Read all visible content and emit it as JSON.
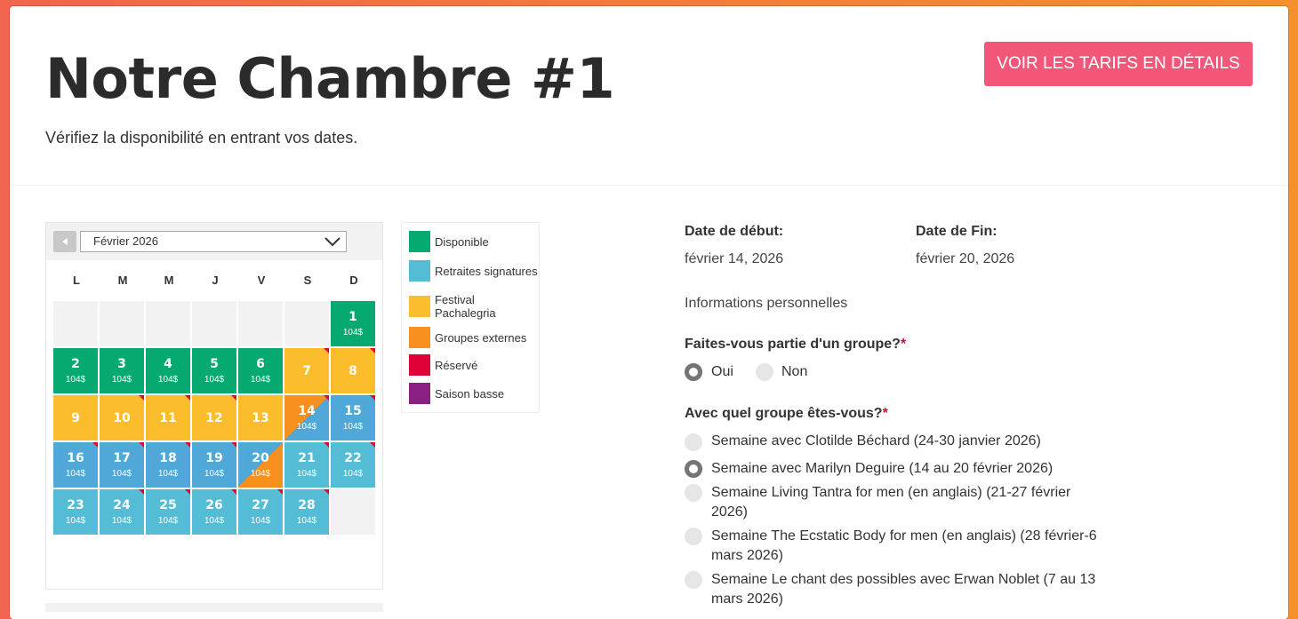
{
  "page": {
    "title": "Notre Chambre #1",
    "subtitle": "Vérifiez la disponibilité en entrant vos dates.",
    "tarifs_button": "VOIR LES TARIFS EN DÉTAILS"
  },
  "calendar": {
    "month": "Février 2026",
    "weekdays": [
      "L",
      "M",
      "M",
      "J",
      "V",
      "S",
      "D"
    ],
    "price": "104$",
    "days": [
      {
        "d": "1",
        "status": "Disponible",
        "price": "104$"
      },
      {
        "d": "2",
        "status": "Disponible",
        "price": "104$"
      },
      {
        "d": "3",
        "status": "Disponible",
        "price": "104$"
      },
      {
        "d": "4",
        "status": "Disponible",
        "price": "104$"
      },
      {
        "d": "5",
        "status": "Disponible",
        "price": "104$"
      },
      {
        "d": "6",
        "status": "Disponible",
        "price": "104$"
      },
      {
        "d": "7",
        "status": "Festival Pachalegria",
        "price": ""
      },
      {
        "d": "8",
        "status": "Festival Pachalegria",
        "price": ""
      },
      {
        "d": "9",
        "status": "Festival Pachalegria",
        "price": ""
      },
      {
        "d": "10",
        "status": "Festival Pachalegria",
        "price": ""
      },
      {
        "d": "11",
        "status": "Festival Pachalegria",
        "price": ""
      },
      {
        "d": "12",
        "status": "Festival Pachalegria",
        "price": ""
      },
      {
        "d": "13",
        "status": "Festival Pachalegria",
        "price": ""
      },
      {
        "d": "14",
        "status": "Groupes externes / Retraites signatures",
        "price": "104$"
      },
      {
        "d": "15",
        "status": "Retraites signatures",
        "price": "104$"
      },
      {
        "d": "16",
        "status": "Retraites signatures",
        "price": "104$"
      },
      {
        "d": "17",
        "status": "Retraites signatures",
        "price": "104$"
      },
      {
        "d": "18",
        "status": "Retraites signatures",
        "price": "104$"
      },
      {
        "d": "19",
        "status": "Retraites signatures",
        "price": "104$"
      },
      {
        "d": "20",
        "status": "Retraites signatures / Groupes externes",
        "price": "104$"
      },
      {
        "d": "21",
        "status": "Retraites signatures",
        "price": "104$"
      },
      {
        "d": "22",
        "status": "Retraites signatures",
        "price": "104$"
      },
      {
        "d": "23",
        "status": "Retraites signatures",
        "price": "104$"
      },
      {
        "d": "24",
        "status": "Retraites signatures",
        "price": "104$"
      },
      {
        "d": "25",
        "status": "Retraites signatures",
        "price": "104$"
      },
      {
        "d": "26",
        "status": "Retraites signatures",
        "price": "104$"
      },
      {
        "d": "27",
        "status": "Retraites signatures",
        "price": "104$"
      },
      {
        "d": "28",
        "status": "Retraites signatures",
        "price": "104$"
      }
    ]
  },
  "legend": [
    {
      "label": "Disponible",
      "color": "#06a970"
    },
    {
      "label": "Retraites signatures",
      "color": "#55bcd6"
    },
    {
      "label": "Festival Pachalegria",
      "color": "#fbbd2c"
    },
    {
      "label": "Groupes externes",
      "color": "#f7901e"
    },
    {
      "label": "Réservé",
      "color": "#e0003a"
    },
    {
      "label": "Saison basse",
      "color": "#8c1f82"
    }
  ],
  "form": {
    "start_label": "Date de début:",
    "start_value": "février 14, 2026",
    "end_label": "Date de Fin:",
    "end_value": "février 20, 2026",
    "section": "Informations personnelles",
    "group_question": "Faites-vous partie d'un groupe?",
    "group_options": [
      "Oui",
      "Non"
    ],
    "group_selected": "Oui",
    "which_group_question": "Avec quel groupe êtes-vous?",
    "groups": [
      {
        "label": "Semaine avec Clotilde Béchard (24-30 janvier 2026)",
        "checked": false
      },
      {
        "label": "Semaine avec Marilyn Deguire (14 au 20 février 2026)",
        "checked": true
      },
      {
        "label": "Semaine Living Tantra for men (en anglais) (21-27 février 2026)",
        "checked": false
      },
      {
        "label": "Semaine The Ecstatic Body for men (en anglais) (28 février-6 mars 2026)",
        "checked": false
      },
      {
        "label": "Semaine Le chant des possibles avec Erwan Noblet (7 au 13 mars 2026)",
        "checked": false
      }
    ],
    "required_mark": "*"
  }
}
